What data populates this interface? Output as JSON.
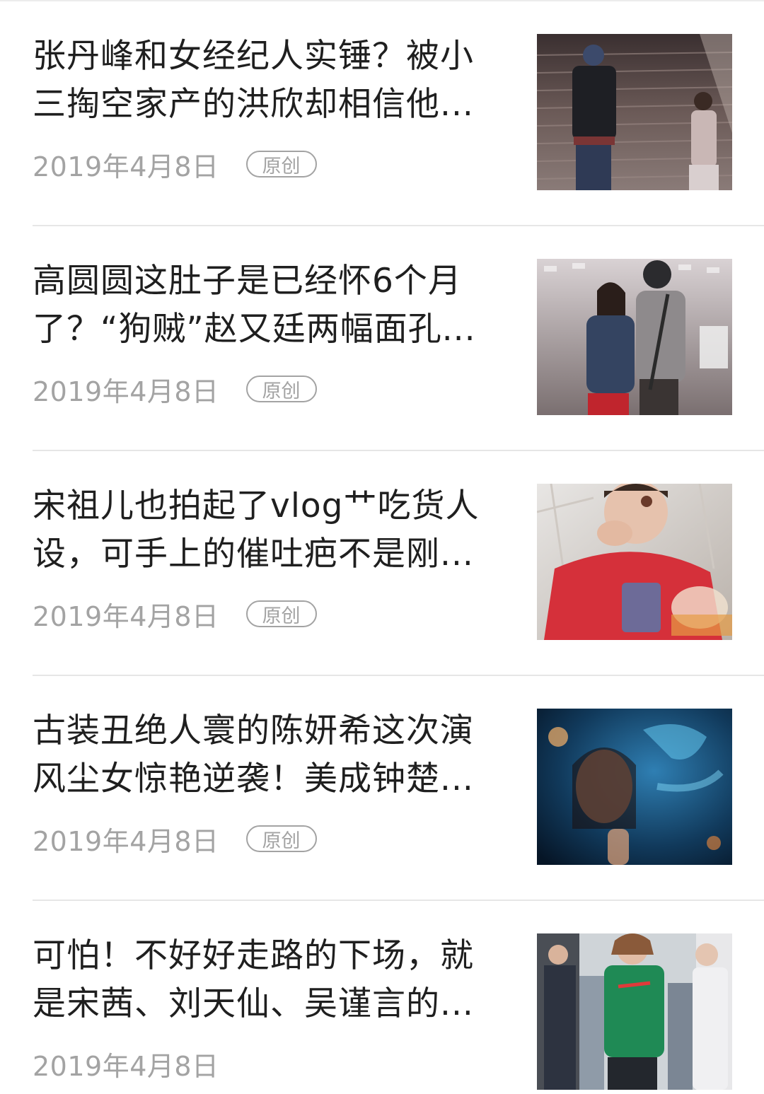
{
  "articles": [
    {
      "title_line1": "张丹峰和女经纪人实锤？被小",
      "title_line2": "三掏空家产的洪欣却相信他...",
      "date": "2019年4月8日",
      "badge": "原创",
      "thumbnail": "photo-couple-on-stairs"
    },
    {
      "title_line1": "高圆圆这肚子是已经怀6个月",
      "title_line2": "了？“狗贼”赵又廷两幅面孔...",
      "date": "2019年4月8日",
      "badge": "原创",
      "thumbnail": "photo-couple-at-airport"
    },
    {
      "title_line1": "宋祖儿也拍起了vlog艹吃货人",
      "title_line2": "设，可手上的催吐疤不是刚...",
      "date": "2019年4月8日",
      "badge": "原创",
      "thumbnail": "photo-girl-eating-red-sweater"
    },
    {
      "title_line1": "古装丑绝人寰的陈妍希这次演",
      "title_line2": "风尘女惊艳逆袭！美成钟楚...",
      "date": "2019年4月8日",
      "badge": "原创",
      "thumbnail": "photo-woman-blue-neon"
    },
    {
      "title_line1": "可怕！不好好走路的下场，就",
      "title_line2": "是宋茜、刘天仙、吴谨言的...",
      "date": "2019年4月8日",
      "thumbnail": "photo-crowd-green-shirt"
    }
  ]
}
